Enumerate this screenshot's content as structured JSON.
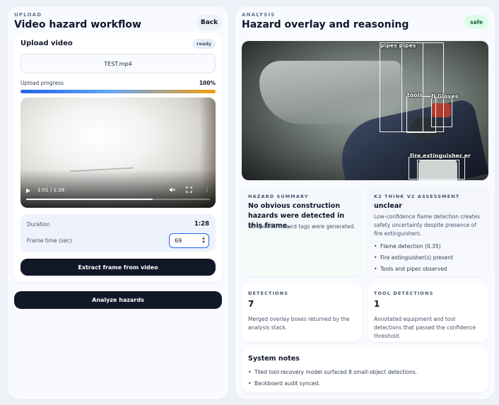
{
  "upload_panel": {
    "eyebrow": "UPLOAD",
    "title": "Video hazard workflow",
    "back_label": "Back",
    "card_title": "Upload video",
    "status_badge": "ready",
    "file_name": "TEST.mp4",
    "progress_label": "Upload progress",
    "progress_value": "100%",
    "progress_fraction": 1.0,
    "video": {
      "time": "1:01 / 1:28",
      "played_fraction": 0.69,
      "play_icon": "play-icon",
      "volume_icon": "mute-icon",
      "fullscreen_icon": "fullscreen-icon",
      "more_icon": "more-vertical-icon"
    },
    "duration_label": "Duration",
    "duration_value": "1:28",
    "frame_time_label": "Frame time (sec)",
    "frame_time_value": "69",
    "extract_label": "Extract frame from video",
    "analyze_label": "Analyze hazards"
  },
  "analysis_panel": {
    "eyebrow": "ANALYSIS",
    "title": "Hazard overlay and reasoning",
    "status_badge": "safe",
    "overlay_labels": {
      "pipes": "pipes pipes",
      "tools": "tools",
      "gloves": "fl Gloves",
      "extinguisher": "fire extinguisher er"
    },
    "hazard_summary": {
      "eyebrow": "HAZARD SUMMARY",
      "headline": "No obvious construction hazards were detected in this frame.",
      "body": "No specific hazard tags were generated."
    },
    "k2": {
      "eyebrow": "K2 THINK V2 ASSESSMENT",
      "verdict": "unclear",
      "body": "Low-confidence flame detection creates safety uncertainty despite presence of fire extinguishers.",
      "bullets": [
        "Flame detection (0.35)",
        "Fire extinguisher(s) present",
        "Tools and pipes observed"
      ]
    },
    "detections": {
      "eyebrow": "DETECTIONS",
      "count": "7",
      "body": "Merged overlay boxes returned by the analysis stack."
    },
    "tool_detections": {
      "eyebrow": "TOOL DETECTIONS",
      "count": "1",
      "body": "Annotated equipment and tool detections that passed the confidence threshold."
    },
    "system_notes": {
      "title": "System notes",
      "items": [
        "Tiled tool-recovery model surfaced 8 small-object detections.",
        "Backboard audit synced."
      ]
    }
  },
  "colors": {
    "dark_button": "#111827",
    "accent_blue": "#2563eb",
    "safe_green": "#166534",
    "safe_bg": "#dcfce7"
  }
}
